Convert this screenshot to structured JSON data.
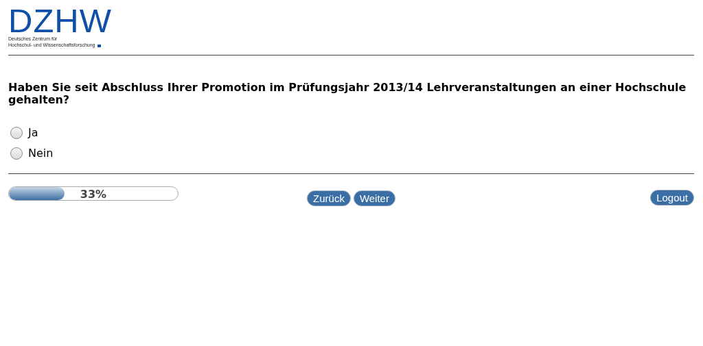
{
  "logo": {
    "wordmark": "DZHW",
    "subtitle_lines": [
      "Deutsches Zentrum für",
      "Hochschul- und Wissenschaftsforschung"
    ]
  },
  "question": "Haben Sie seit Abschluss Ihrer Promotion im Prüfungsjahr 2013/14 Lehrveranstaltungen an einer Hochschule gehalten?",
  "options": [
    {
      "label": "Ja",
      "selected": false
    },
    {
      "label": "Nein",
      "selected": false
    }
  ],
  "progress": {
    "level": 0.33,
    "reading": "33%"
  },
  "nav_buttons": [
    "Zurück",
    "Weiter"
  ],
  "logout_button": "Logout"
}
